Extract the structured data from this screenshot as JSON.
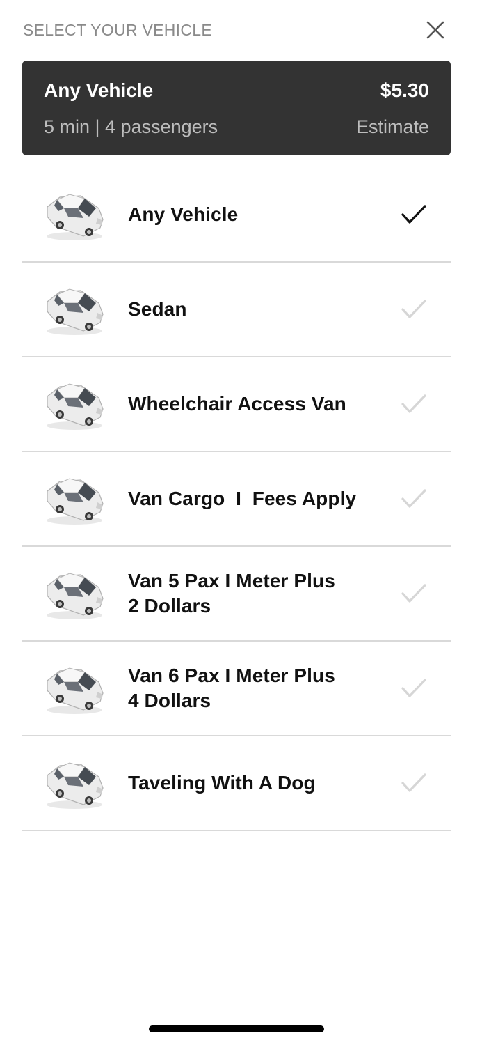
{
  "header": {
    "title": "SELECT YOUR VEHICLE",
    "close_icon": "close-icon"
  },
  "summary": {
    "name": "Any Vehicle",
    "price": "$5.30",
    "detail": "5 min | 4 passengers",
    "estimate_label": "Estimate"
  },
  "vehicles": [
    {
      "label": "Any Vehicle",
      "selected": true,
      "icon": "car-icon"
    },
    {
      "label": "Sedan",
      "selected": false,
      "icon": "car-icon"
    },
    {
      "label": "Wheelchair Access Van",
      "selected": false,
      "icon": "car-icon"
    },
    {
      "label": "Van Cargo  I  Fees Apply",
      "selected": false,
      "icon": "car-icon"
    },
    {
      "label": "Van 5 Pax I Meter Plus 2 Dollars",
      "selected": false,
      "icon": "car-icon"
    },
    {
      "label": "Van 6 Pax  I  Meter Plus 4 Dollars",
      "selected": false,
      "icon": "car-icon"
    },
    {
      "label": "Taveling With A Dog",
      "selected": false,
      "icon": "car-icon"
    }
  ],
  "colors": {
    "summary_bg": "#333333",
    "check_selected": "#111111",
    "check_unselected": "#d6d6d6",
    "divider": "#d9d9d9"
  }
}
